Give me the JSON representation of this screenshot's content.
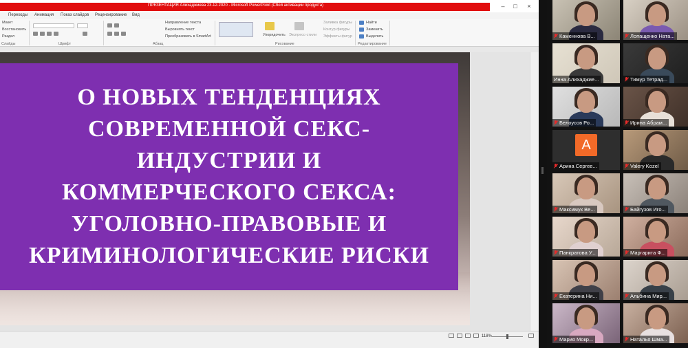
{
  "window": {
    "title": "ПРЕЗЕНТАЦИЯ Алихаджиева 23.12.2020 - Microsoft PowerPoint (Сбой активации продукта)",
    "minimize_glyph": "–",
    "restore_glyph": "□",
    "close_glyph": "×",
    "title_color": "#e10d0d"
  },
  "ribbon": {
    "tabs": [
      "Переходы",
      "Анимация",
      "Показ слайдов",
      "Рецензирование",
      "Вид"
    ],
    "clipboard_items": [
      "Макет",
      "Восстановить",
      "Раздел"
    ],
    "group_labels": [
      "Слайды",
      "Шрифт",
      "Абзац",
      "Рисование",
      "Редактирование"
    ],
    "paragraph_items": [
      "Направление текста",
      "Выровнять текст",
      "Преобразовать в SmartArt"
    ],
    "arrange_label": "Упорядочить",
    "quick_styles_label": "Экспресс-стили",
    "shape_items": [
      "Заливка фигуры",
      "Контур фигуры",
      "Эффекты фигур"
    ],
    "edit_items": [
      "Найти",
      "Заменить",
      "Выделить"
    ]
  },
  "slide": {
    "title_lines": [
      "О НОВЫХ ТЕНДЕНЦИЯХ",
      "СОВРЕМЕННОЙ СЕКС-",
      "ИНДУСТРИИ И",
      "КОММЕРЧЕСКОГО СЕКСА:",
      "УГОЛОВНО-ПРАВОВЫЕ И",
      "КРИМИНОЛОГИЧЕСКИЕ РИСКИ"
    ],
    "box_color": "#7e2fb0"
  },
  "statusbar": {
    "zoom": "118%"
  },
  "participants": [
    {
      "name": "Каменнова В...",
      "muted": true
    },
    {
      "name": "Лопащенко Ната...",
      "muted": true
    },
    {
      "name": "Инна Алихаджие...",
      "muted": false,
      "active": true
    },
    {
      "name": "Тимур Тетрад...",
      "muted": true
    },
    {
      "name": "Белоусов Ро...",
      "muted": true
    },
    {
      "name": "Ирина Абрам...",
      "muted": true
    },
    {
      "name": "Арина Сергее...",
      "muted": true,
      "avatar_letter": "А"
    },
    {
      "name": "Valery Kozel",
      "muted": true
    },
    {
      "name": "Максимук Ве...",
      "muted": true
    },
    {
      "name": "Байгузов Иго...",
      "muted": true
    },
    {
      "name": "Панкратова У...",
      "muted": true
    },
    {
      "name": "Маргарита Ф...",
      "muted": true
    },
    {
      "name": "Екатерина Ни...",
      "muted": true
    },
    {
      "name": "Альбина Мир...",
      "muted": true
    },
    {
      "name": "Мария Мокр...",
      "muted": true
    },
    {
      "name": "Наталья Шма...",
      "muted": true
    }
  ],
  "colors": {
    "active_speaker": "#d4e01e",
    "muted_icon": "#e82a2a",
    "avatar": "#f26a28"
  }
}
